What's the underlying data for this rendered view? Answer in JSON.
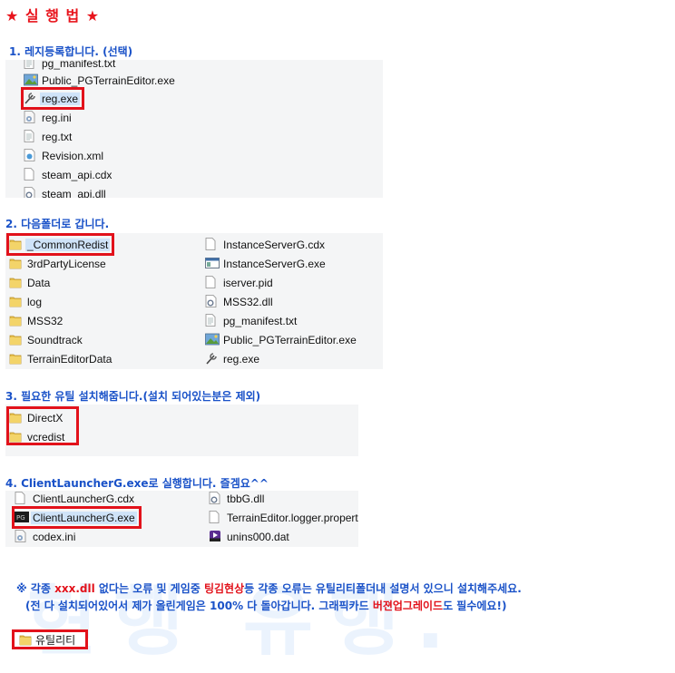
{
  "title": "★ 실 행 법 ★",
  "watermark_text": "현행 유행.",
  "steps": {
    "s1": "1. 레지등록합니다. (선택)",
    "s2": "2. 다음폴더로 갑니다.",
    "s3": "3.  필요한 유틸 설치해줍니다.(설치 되어있는분은 제외)",
    "s4": "4. ClientLauncherG.exe로 실행합니다. 즐겜요^^"
  },
  "panel1": {
    "items": [
      {
        "name": "pg_manifest.txt",
        "icon": "text-file-icon"
      },
      {
        "name": "Public_PGTerrainEditor.exe",
        "icon": "editor-exe-icon"
      },
      {
        "name": "reg.exe",
        "icon": "reg-exe-icon"
      },
      {
        "name": "reg.ini",
        "icon": "settings-file-icon"
      },
      {
        "name": "reg.txt",
        "icon": "text-file-icon"
      },
      {
        "name": "Revision.xml",
        "icon": "xml-file-icon"
      },
      {
        "name": "steam_api.cdx",
        "icon": "file-icon"
      },
      {
        "name": "steam_api.dll",
        "icon": "dll-file-icon"
      }
    ]
  },
  "panel2": {
    "left": [
      {
        "name": "_CommonRedist",
        "icon": "folder-icon"
      },
      {
        "name": "3rdPartyLicense",
        "icon": "folder-icon"
      },
      {
        "name": "Data",
        "icon": "folder-icon"
      },
      {
        "name": "log",
        "icon": "folder-icon"
      },
      {
        "name": "MSS32",
        "icon": "folder-icon"
      },
      {
        "name": "Soundtrack",
        "icon": "folder-icon"
      },
      {
        "name": "TerrainEditorData",
        "icon": "folder-icon"
      }
    ],
    "right": [
      {
        "name": "InstanceServerG.cdx",
        "icon": "file-icon"
      },
      {
        "name": "InstanceServerG.exe",
        "icon": "window-exe-icon"
      },
      {
        "name": "iserver.pid",
        "icon": "file-icon"
      },
      {
        "name": "MSS32.dll",
        "icon": "dll-file-icon"
      },
      {
        "name": "pg_manifest.txt",
        "icon": "text-file-icon"
      },
      {
        "name": "Public_PGTerrainEditor.exe",
        "icon": "editor-exe-icon"
      },
      {
        "name": "reg.exe",
        "icon": "reg-exe-icon"
      }
    ]
  },
  "panel3": {
    "items": [
      {
        "name": "DirectX",
        "icon": "folder-icon"
      },
      {
        "name": "vcredist",
        "icon": "folder-icon"
      }
    ]
  },
  "panel4": {
    "left": [
      {
        "name": "ClientLauncherG.cdx",
        "icon": "file-icon"
      },
      {
        "name": "ClientLauncherG.exe",
        "icon": "launcher-exe-icon"
      },
      {
        "name": "codex.ini",
        "icon": "settings-file-icon"
      }
    ],
    "right": [
      {
        "name": "tbbG.dll",
        "icon": "dll-file-icon"
      },
      {
        "name": "TerrainEditor.logger.propert",
        "icon": "file-icon"
      },
      {
        "name": "unins000.dat",
        "icon": "dat-file-icon"
      }
    ]
  },
  "notice": {
    "line1_a": "※ 각종 ",
    "line1_b": "xxx.dll",
    "line1_c": " 없다는 오류 및 게임중 ",
    "line1_d": "팅김현상",
    "line1_e": "등 각종 오류는 유틸리티폴더내 설명서 있으니 설치해주세요.",
    "line2_a": "(전 다 설치되어있어서 제가 올린게임은 100% 다 돌아갑니다. 그래픽카드 ",
    "line2_b": "버젼업그레이드",
    "line2_c": "도 필수에요!)"
  },
  "utility_folder": "유틸리티",
  "colors": {
    "accent_red": "#e2121b",
    "step_blue": "#1a52c8",
    "folder_yellow": "#e8c14a"
  }
}
